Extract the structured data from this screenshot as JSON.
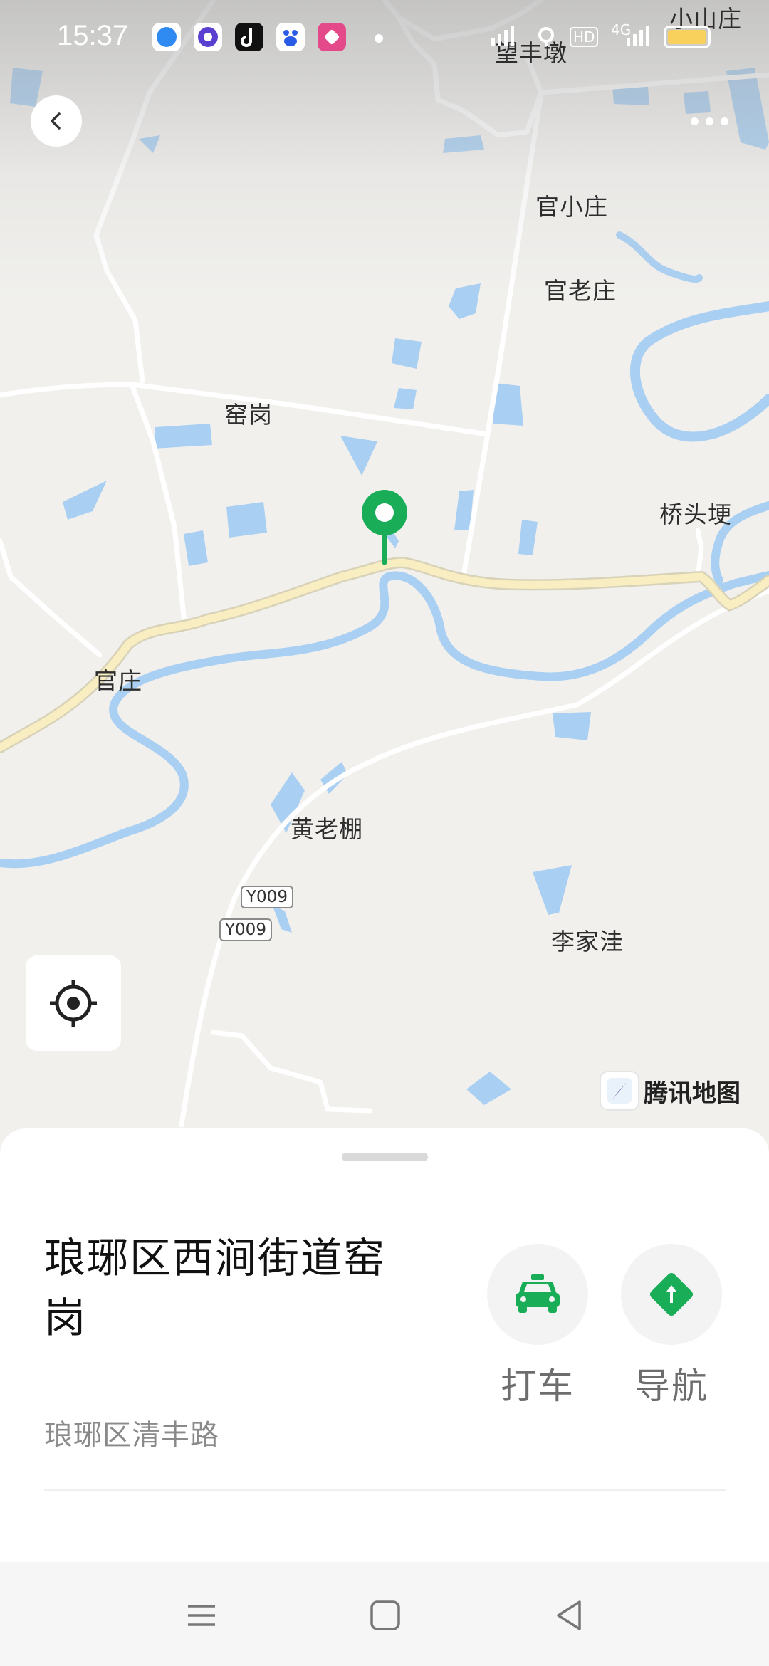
{
  "status_bar": {
    "time": "15:37",
    "network_label": "4G",
    "hd_label": "HD",
    "app_icons": [
      "browser-app-icon",
      "star-app-icon",
      "tiktok-app-icon",
      "baidu-app-icon",
      "shortcut-app-icon"
    ]
  },
  "map": {
    "places": {
      "xiaoshanzhuang": "小山庄",
      "wangfengdun": "望丰墩",
      "guanxiaozhuang": "官小庄",
      "guanlaozhuang": "官老庄",
      "yaogang": "窑岗",
      "qiaotougeng": "桥头埂",
      "guanzhuang": "官庄",
      "huanglaopeng": "黄老棚",
      "lijiawa": "李家洼"
    },
    "road_shields": [
      "Y009",
      "Y009"
    ],
    "brand": "腾讯地图",
    "colors": {
      "water": "#a9cff2",
      "main_road": "#f8eec2",
      "pin": "#1aad57"
    }
  },
  "location": {
    "title": "琅琊区西涧街道窑岗",
    "address": "琅琊区清丰路"
  },
  "actions": {
    "taxi_label": "打车",
    "navigate_label": "导航"
  }
}
